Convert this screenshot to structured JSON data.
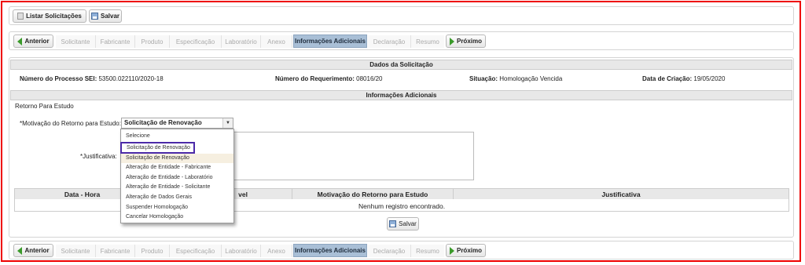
{
  "toolbar": {
    "list_label": "Listar Solicitações",
    "save_label": "Salvar"
  },
  "wizard": {
    "prev_label": "Anterior",
    "next_label": "Próximo",
    "steps": [
      "Solicitante",
      "Fabricante",
      "Produto",
      "Especificação",
      "Laboratório",
      "Anexo",
      "Informações Adicionais",
      "Declaração",
      "Resumo"
    ],
    "active_step": "Informações Adicionais"
  },
  "dados": {
    "title": "Dados da Solicitação",
    "processo_label": "Número do Processo SEI:",
    "processo_value": "53500.022110/2020-18",
    "requerimento_label": "Número do Requerimento:",
    "requerimento_value": "08016/20",
    "situacao_label": "Situação:",
    "situacao_value": "Homologação Vencida",
    "criacao_label": "Data de Criação:",
    "criacao_value": "19/05/2020"
  },
  "info": {
    "title": "Informações Adicionais",
    "section_label": "Retorno Para Estudo",
    "motivacao_label": "*Motivação do Retorno para Estudo:",
    "motivacao_value": "Solicitação de Renovação",
    "justificativa_label": "*Justificativa:",
    "options": [
      "Selecione",
      "Solicitação de Renovação",
      "Solicitação de Renovação",
      "Alteração de Entidade - Fabricante",
      "Alteração de Entidade - Laboratório",
      "Alteração de Entidade - Solicitante",
      "Alteração de Dados Gerais",
      "Suspender Homologação",
      "Cancelar Homologação"
    ]
  },
  "table": {
    "columns": [
      "Data - Hora",
      "vel",
      "Motivação do Retorno para Estudo",
      "Justificativa"
    ],
    "empty_text": "Nenhum registro encontrado."
  },
  "save_label": "Salvar",
  "colors": {
    "frame": "#e00000",
    "highlight": "#4b2aa8",
    "active_step": "#a9bfd6",
    "arrow": "#3a9a2a"
  }
}
